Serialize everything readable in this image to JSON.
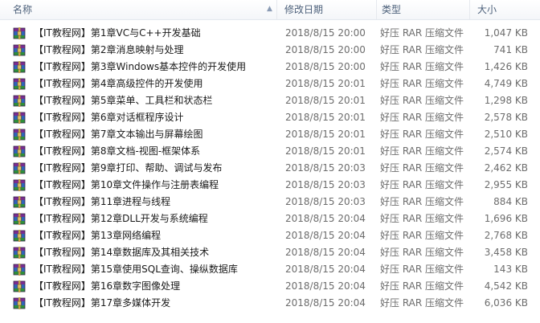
{
  "columns": {
    "name": "名称",
    "date": "修改日期",
    "type": "类型",
    "size": "大小"
  },
  "icons": {
    "file": "winrar-archive-icon",
    "sort": "sort-up-icon"
  },
  "rows": [
    {
      "name": "【IT教程网】第1章VC与C++开发基础",
      "date": "2018/8/15 20:00",
      "type": "好压 RAR 压缩文件",
      "size": "1,047 KB"
    },
    {
      "name": "【IT教程网】第2章消息映射与处理",
      "date": "2018/8/15 20:00",
      "type": "好压 RAR 压缩文件",
      "size": "741 KB"
    },
    {
      "name": "【IT教程网】第3章Windows基本控件的开发使用",
      "date": "2018/8/15 20:00",
      "type": "好压 RAR 压缩文件",
      "size": "1,426 KB"
    },
    {
      "name": "【IT教程网】第4章高级控件的开发使用",
      "date": "2018/8/15 20:01",
      "type": "好压 RAR 压缩文件",
      "size": "4,749 KB"
    },
    {
      "name": "【IT教程网】第5章菜单、工具栏和状态栏",
      "date": "2018/8/15 20:01",
      "type": "好压 RAR 压缩文件",
      "size": "1,298 KB"
    },
    {
      "name": "【IT教程网】第6章对话框程序设计",
      "date": "2018/8/15 20:01",
      "type": "好压 RAR 压缩文件",
      "size": "2,578 KB"
    },
    {
      "name": "【IT教程网】第7章文本输出与屏幕绘图",
      "date": "2018/8/15 20:01",
      "type": "好压 RAR 压缩文件",
      "size": "2,510 KB"
    },
    {
      "name": "【IT教程网】第8章文档-视图-框架体系",
      "date": "2018/8/15 20:01",
      "type": "好压 RAR 压缩文件",
      "size": "2,574 KB"
    },
    {
      "name": "【IT教程网】第9章打印、帮助、调试与发布",
      "date": "2018/8/15 20:03",
      "type": "好压 RAR 压缩文件",
      "size": "2,462 KB"
    },
    {
      "name": "【IT教程网】第10章文件操作与注册表编程",
      "date": "2018/8/15 20:03",
      "type": "好压 RAR 压缩文件",
      "size": "2,955 KB"
    },
    {
      "name": "【IT教程网】第11章进程与线程",
      "date": "2018/8/15 20:03",
      "type": "好压 RAR 压缩文件",
      "size": "884 KB"
    },
    {
      "name": "【IT教程网】第12章DLL开发与系统编程",
      "date": "2018/8/15 20:04",
      "type": "好压 RAR 压缩文件",
      "size": "1,696 KB"
    },
    {
      "name": "【IT教程网】第13章网络编程",
      "date": "2018/8/15 20:04",
      "type": "好压 RAR 压缩文件",
      "size": "2,768 KB"
    },
    {
      "name": "【IT教程网】第14章数据库及其相关技术",
      "date": "2018/8/15 20:04",
      "type": "好压 RAR 压缩文件",
      "size": "3,458 KB"
    },
    {
      "name": "【IT教程网】第15章使用SQL查询、操纵数据库",
      "date": "2018/8/15 20:04",
      "type": "好压 RAR 压缩文件",
      "size": "143 KB"
    },
    {
      "name": "【IT教程网】第16章数字图像处理",
      "date": "2018/8/15 20:04",
      "type": "好压 RAR 压缩文件",
      "size": "4,542 KB"
    },
    {
      "name": "【IT教程网】第17章多媒体开发",
      "date": "2018/8/15 20:04",
      "type": "好压 RAR 压缩文件",
      "size": "6,036 KB"
    }
  ]
}
